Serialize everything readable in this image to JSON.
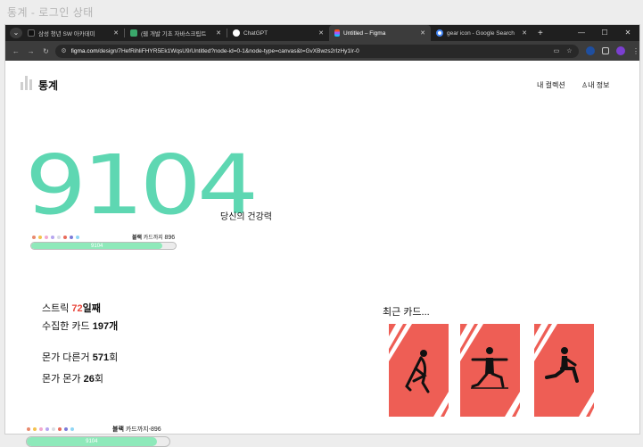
{
  "window_title": "통계 - 로그인 상태",
  "tabs": [
    {
      "title": "삼성 청년 SW 아카데미",
      "favicon": "ssafy-favicon",
      "color": "#111111",
      "active": false
    },
    {
      "title": "(웹 개발 기초 자바스크립트",
      "favicon": "page-favicon",
      "color": "#3aa86b",
      "active": false
    },
    {
      "title": "ChatGPT",
      "favicon": "chatgpt-favicon",
      "color": "#ffffff",
      "active": false
    },
    {
      "title": "Untitled – Figma",
      "favicon": "figma-favicon",
      "color": "#f24e1e",
      "active": true
    },
    {
      "title": "gear icon - Google Search",
      "favicon": "google-favicon",
      "color": "#4285f4",
      "active": false
    }
  ],
  "new_tab": "+",
  "win_controls": {
    "minimize": "—",
    "maximize": "☐",
    "close": "✕"
  },
  "url": {
    "host": "figma.com",
    "path": "/design/7HefRihliFHYR5Ek1WqsU9/Untitled?node-id=0-1&node-type=canvas&t=GvXBwzs2rIzHy1Ir-0"
  },
  "app": {
    "logo_text": "통계",
    "nav": {
      "my_collection": "내 컬렉션",
      "my_info": "내 정보"
    }
  },
  "score": {
    "value": "9104",
    "label": "당신의 건강력"
  },
  "progress_top": {
    "goal_prefix": "블랙",
    "goal_label": "카드까지",
    "goal_value": "896",
    "value_label": "9104",
    "fraction": 0.91
  },
  "progress_bottom": {
    "goal_prefix": "블랙",
    "goal_label": "카드까지",
    "goal_value": "-896",
    "value_label": "9104",
    "fraction": 0.91
  },
  "dot_colors": [
    "#e8896d",
    "#f4c24d",
    "#f2a8cf",
    "#b7a6f0",
    "#d9dde3",
    "#e86a5a",
    "#7c7bd8",
    "#8fd6f5"
  ],
  "stats": {
    "streak": {
      "prefix": "스트릭 ",
      "value": "72",
      "suffix": "일째"
    },
    "cards": {
      "prefix": "수집한 카드 ",
      "value": "197",
      "suffix": "개"
    },
    "tried": {
      "prefix": "몬가 다른거 ",
      "value": "571",
      "suffix": "회"
    },
    "monga": {
      "prefix": "몬가 몬가 ",
      "value": "26",
      "suffix": "회"
    }
  },
  "recent": {
    "title": "최근 카드...",
    "cards": [
      {
        "icon": "yoga-stretch-icon"
      },
      {
        "icon": "warrior-pose-icon"
      },
      {
        "icon": "lunge-stretch-icon"
      }
    ],
    "card_color": "#ee5e55"
  }
}
